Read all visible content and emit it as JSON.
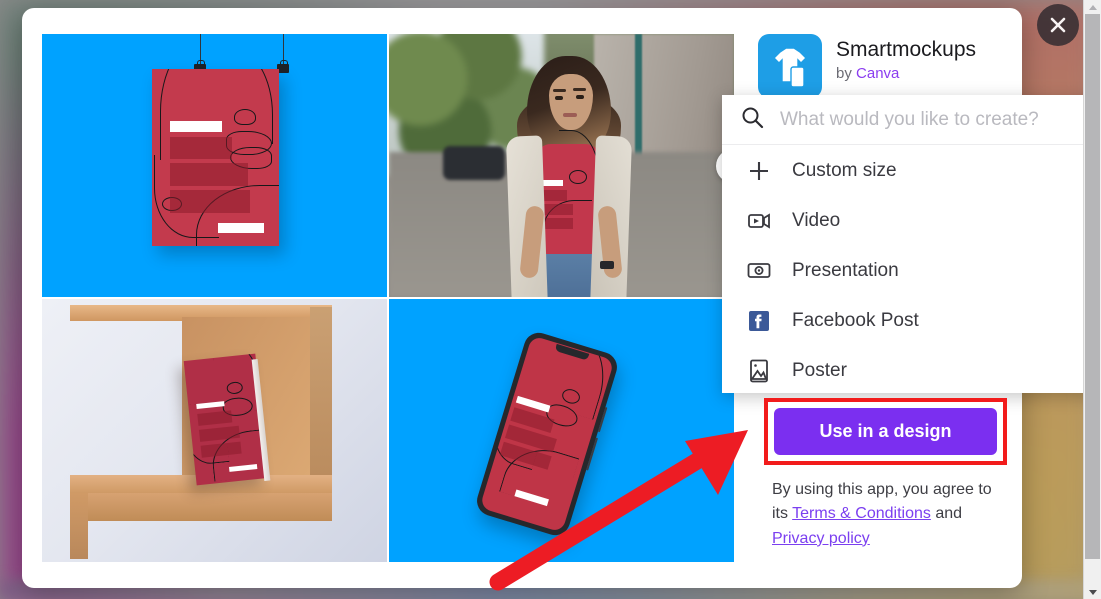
{
  "app": {
    "logo_icon": "tshirt-phone-logo-icon",
    "name": "Smartmockups",
    "by_prefix": "by ",
    "by_brand": "Canva"
  },
  "search": {
    "icon": "search-icon",
    "value": "",
    "placeholder": "What would you like to create?"
  },
  "dropdown": {
    "items": [
      {
        "label": "Custom size",
        "icon": "plus-icon"
      },
      {
        "label": "Video",
        "icon": "video-camera-icon"
      },
      {
        "label": "Presentation",
        "icon": "presentation-icon"
      },
      {
        "label": "Facebook Post",
        "icon": "facebook-icon"
      },
      {
        "label": "Poster",
        "icon": "image-poster-icon"
      }
    ],
    "scrollbar": {
      "up_icon": "scroll-up-arrow-icon",
      "down_icon": "scroll-down-arrow-icon"
    }
  },
  "cta": {
    "label": "Use in a design",
    "highlight_color": "#f21b1b",
    "button_color": "#7b2ff0"
  },
  "legal": {
    "text_before": "By using this app, you agree to its ",
    "terms_link": "Terms & Conditions",
    "text_middle": " and ",
    "privacy_link": "Privacy policy"
  },
  "window": {
    "close_icon": "close-icon"
  },
  "annotation": {
    "arrow_icon": "red-pointer-arrow-icon",
    "arrow_color": "#ed1c24"
  },
  "gallery": {
    "carousel_next_icon": "carousel-next-arrow-icon",
    "items": [
      {
        "name": "hanging-poster-mockup",
        "background": "#00a2ff"
      },
      {
        "name": "tshirt-on-model-photo-mockup",
        "background": "#8d8a86"
      },
      {
        "name": "book-on-shelf-mockup",
        "background": "#e4e7f0"
      },
      {
        "name": "phone-screen-mockup",
        "background": "#00a2ff"
      }
    ],
    "design_colors": {
      "artwork_red": "#c33a4d",
      "line_art": "#17181a",
      "accent_bar": "#ffffff"
    }
  },
  "scrollbar": {
    "page_up_icon": "page-scroll-up-icon",
    "page_down_icon": "page-scroll-down-icon"
  }
}
